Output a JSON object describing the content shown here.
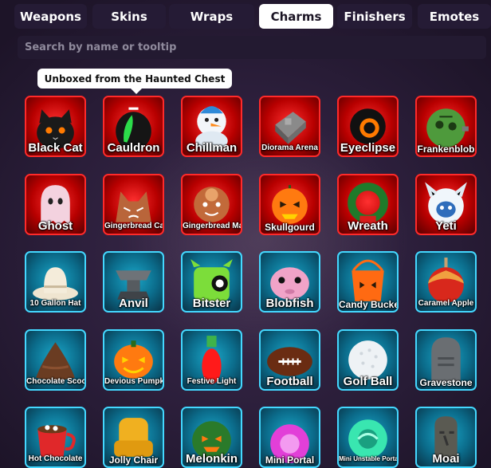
{
  "tabs": [
    {
      "label": "Weapons",
      "active": false
    },
    {
      "label": "Skins",
      "active": false
    },
    {
      "label": "Wraps",
      "active": false
    },
    {
      "label": "Charms",
      "active": true
    },
    {
      "label": "Finishers",
      "active": false
    },
    {
      "label": "Emotes",
      "active": false
    }
  ],
  "search": {
    "placeholder": "Search by name or tooltip",
    "value": ""
  },
  "tooltip": {
    "text": "Unboxed from the Haunted Chest"
  },
  "rows": [
    [
      {
        "name": "Black Cat",
        "rarity": "red",
        "icon": "black-cat-icon"
      },
      {
        "name": "Cauldron",
        "rarity": "red",
        "icon": "cauldron-icon"
      },
      {
        "name": "Chillman",
        "rarity": "red",
        "icon": "snowman-icon"
      },
      {
        "name": "Diorama Arena",
        "rarity": "red",
        "icon": "diorama-arena-icon"
      },
      {
        "name": "Eyeclipse",
        "rarity": "red",
        "icon": "eyeclipse-icon"
      },
      {
        "name": "Frankenblob",
        "rarity": "red",
        "icon": "frankenblob-icon"
      }
    ],
    [
      {
        "name": "Ghost",
        "rarity": "red",
        "icon": "ghost-icon"
      },
      {
        "name": "Gingerbread Cat",
        "rarity": "red",
        "icon": "gingerbread-cat-icon"
      },
      {
        "name": "Gingerbread Man",
        "rarity": "red",
        "icon": "gingerbread-man-icon"
      },
      {
        "name": "Skullgourd",
        "rarity": "red",
        "icon": "skullgourd-icon"
      },
      {
        "name": "Wreath",
        "rarity": "red",
        "icon": "wreath-icon"
      },
      {
        "name": "Yeti",
        "rarity": "red",
        "icon": "yeti-icon"
      }
    ],
    [
      {
        "name": "10 Gallon Hat",
        "rarity": "blue",
        "icon": "cowboy-hat-icon"
      },
      {
        "name": "Anvil",
        "rarity": "blue",
        "icon": "anvil-icon"
      },
      {
        "name": "Bitster",
        "rarity": "blue",
        "icon": "bitster-icon"
      },
      {
        "name": "Blobfish",
        "rarity": "blue",
        "icon": "blobfish-icon"
      },
      {
        "name": "Candy Bucket",
        "rarity": "blue",
        "icon": "candy-bucket-icon"
      },
      {
        "name": "Caramel Apple",
        "rarity": "blue",
        "icon": "caramel-apple-icon"
      }
    ],
    [
      {
        "name": "Chocolate Scoop",
        "rarity": "blue",
        "icon": "chocolate-scoop-icon"
      },
      {
        "name": "Devious Pumpkin",
        "rarity": "blue",
        "icon": "devious-pumpkin-icon"
      },
      {
        "name": "Festive Light",
        "rarity": "blue",
        "icon": "festive-light-icon"
      },
      {
        "name": "Football",
        "rarity": "blue",
        "icon": "football-icon"
      },
      {
        "name": "Golf Ball",
        "rarity": "blue",
        "icon": "golf-ball-icon"
      },
      {
        "name": "Gravestone",
        "rarity": "blue",
        "icon": "gravestone-icon"
      }
    ],
    [
      {
        "name": "Hot Chocolate",
        "rarity": "blue",
        "icon": "hot-chocolate-icon"
      },
      {
        "name": "Jolly Chair",
        "rarity": "blue",
        "icon": "jolly-chair-icon"
      },
      {
        "name": "Melonkin",
        "rarity": "blue",
        "icon": "melonkin-icon"
      },
      {
        "name": "Mini Portal",
        "rarity": "blue",
        "icon": "mini-portal-icon"
      },
      {
        "name": "Mini Unstable Portal",
        "rarity": "blue",
        "icon": "mini-unstable-portal-icon"
      },
      {
        "name": "Moai",
        "rarity": "blue",
        "icon": "moai-icon"
      }
    ]
  ]
}
